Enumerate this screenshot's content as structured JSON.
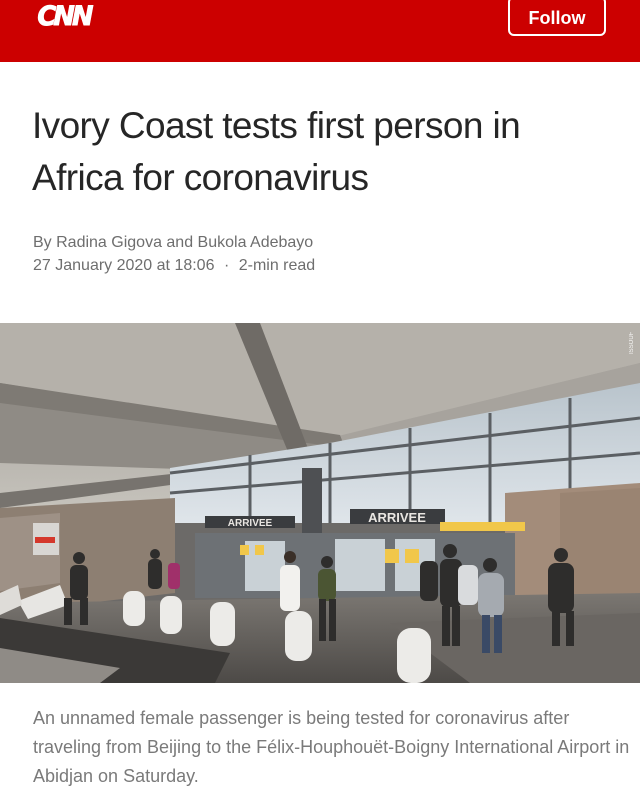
{
  "header": {
    "logo_text": "CNN",
    "follow_label": "Follow",
    "brand_color": "#cc0000"
  },
  "article": {
    "headline": "Ivory Coast tests first person in Africa for coronavirus",
    "byline": "By Radina Gigova and Bukola Adebayo",
    "date": "27 January 2020 at 18:06",
    "separator": "·",
    "read_time": "2-min read"
  },
  "photo": {
    "credit": "ISSOUF SANOGO",
    "signs": {
      "arrivee_left": "ARRIVEE",
      "arrivee_right": "ARRIVEE"
    }
  },
  "caption": {
    "text": "An unnamed female passenger is being tested for coronavirus after traveling from Beijing to the Félix-Houphouët-Boigny International Airport in Abidjan on Saturday."
  }
}
